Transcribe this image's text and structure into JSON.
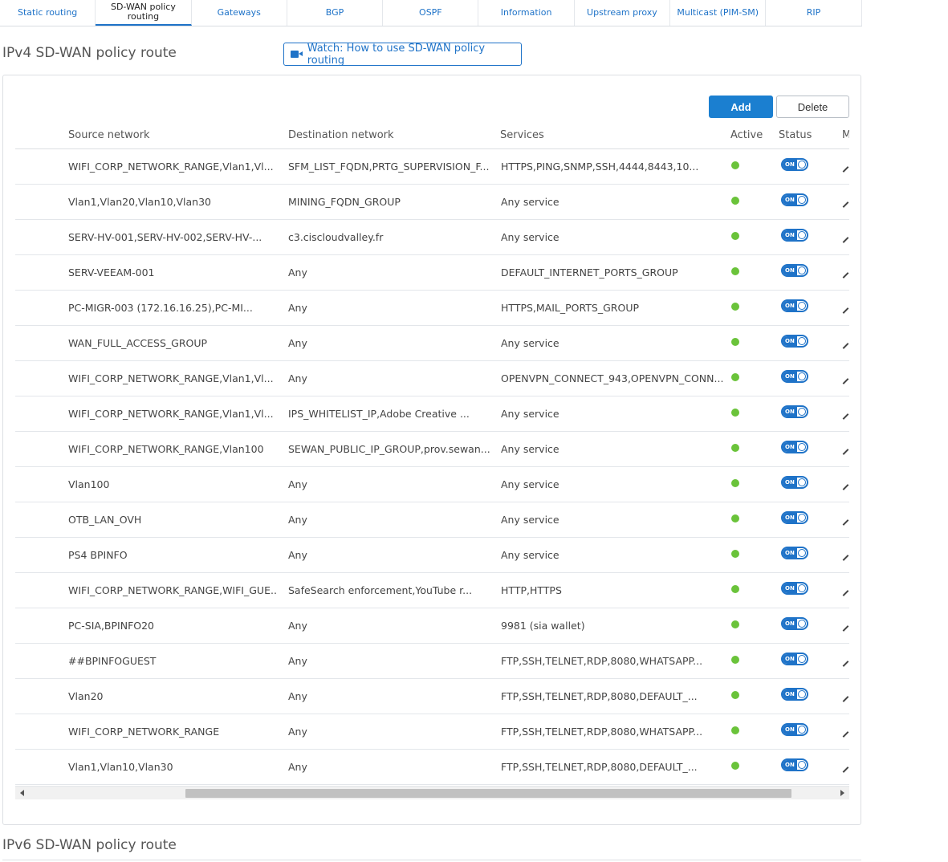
{
  "tabs": [
    {
      "label": "Static routing",
      "active": false
    },
    {
      "label": "SD-WAN policy routing",
      "active": true
    },
    {
      "label": "Gateways",
      "active": false
    },
    {
      "label": "BGP",
      "active": false
    },
    {
      "label": "OSPF",
      "active": false
    },
    {
      "label": "Information",
      "active": false
    },
    {
      "label": "Upstream proxy",
      "active": false
    },
    {
      "label": "Multicast (PIM-SM)",
      "active": false
    },
    {
      "label": "RIP",
      "active": false
    }
  ],
  "ipv4": {
    "title": "IPv4 SD-WAN policy route",
    "watch_label": "Watch: How to use SD-WAN policy routing",
    "add_label": "Add",
    "delete_label": "Delete",
    "headers": {
      "source": "Source network",
      "destination": "Destination network",
      "services": "Services",
      "active": "Active",
      "status": "Status",
      "more": "M"
    },
    "toggle_label": "ON",
    "rows": [
      {
        "source": "WIFI_CORP_NETWORK_RANGE,Vlan1,Vl...",
        "destination": "SFM_LIST_FQDN,PRTG_SUPERVISION_F...",
        "services": "HTTPS,PING,SNMP,SSH,4444,8443,10..."
      },
      {
        "source": "Vlan1,Vlan20,Vlan10,Vlan30",
        "destination": "MINING_FQDN_GROUP",
        "services": "Any service"
      },
      {
        "source": "SERV-HV-001,SERV-HV-002,SERV-HV-...",
        "destination": "c3.ciscloudvalley.fr",
        "services": "Any service"
      },
      {
        "source": "SERV-VEEAM-001",
        "destination": "Any",
        "services": "DEFAULT_INTERNET_PORTS_GROUP"
      },
      {
        "source": "PC-MIGR-003 (172.16.16.25),PC-MI...",
        "destination": "Any",
        "services": "HTTPS,MAIL_PORTS_GROUP"
      },
      {
        "source": "WAN_FULL_ACCESS_GROUP",
        "destination": "Any",
        "services": "Any service"
      },
      {
        "source": "WIFI_CORP_NETWORK_RANGE,Vlan1,Vl...",
        "destination": "Any",
        "services": "OPENVPN_CONNECT_943,OPENVPN_CONN..."
      },
      {
        "source": "WIFI_CORP_NETWORK_RANGE,Vlan1,Vl...",
        "destination": "IPS_WHITELIST_IP,Adobe Creative ...",
        "services": "Any service"
      },
      {
        "source": "WIFI_CORP_NETWORK_RANGE,Vlan100",
        "destination": "SEWAN_PUBLIC_IP_GROUP,prov.sewan...",
        "services": "Any service"
      },
      {
        "source": "Vlan100",
        "destination": "Any",
        "services": "Any service"
      },
      {
        "source": "OTB_LAN_OVH",
        "destination": "Any",
        "services": "Any service"
      },
      {
        "source": "PS4 BPINFO",
        "destination": "Any",
        "services": "Any service"
      },
      {
        "source": "WIFI_CORP_NETWORK_RANGE,WIFI_GUE...",
        "destination": "SafeSearch enforcement,YouTube r...",
        "services": "HTTP,HTTPS"
      },
      {
        "source": "PC-SIA,BPINFO20",
        "destination": "Any",
        "services": "9981 (sia wallet)"
      },
      {
        "source": "##BPINFOGUEST",
        "destination": "Any",
        "services": "FTP,SSH,TELNET,RDP,8080,WHATSAPP..."
      },
      {
        "source": "Vlan20",
        "destination": "Any",
        "services": "FTP,SSH,TELNET,RDP,8080,DEFAULT_..."
      },
      {
        "source": "WIFI_CORP_NETWORK_RANGE",
        "destination": "Any",
        "services": "FTP,SSH,TELNET,RDP,8080,WHATSAPP..."
      },
      {
        "source": "Vlan1,Vlan10,Vlan30",
        "destination": "Any",
        "services": "FTP,SSH,TELNET,RDP,8080,DEFAULT_..."
      }
    ]
  },
  "ipv6": {
    "title": "IPv6 SD-WAN policy route"
  },
  "colors": {
    "accent": "#1f73c8",
    "add_button": "#1b7fd0",
    "active_dot": "#6ac33a"
  }
}
